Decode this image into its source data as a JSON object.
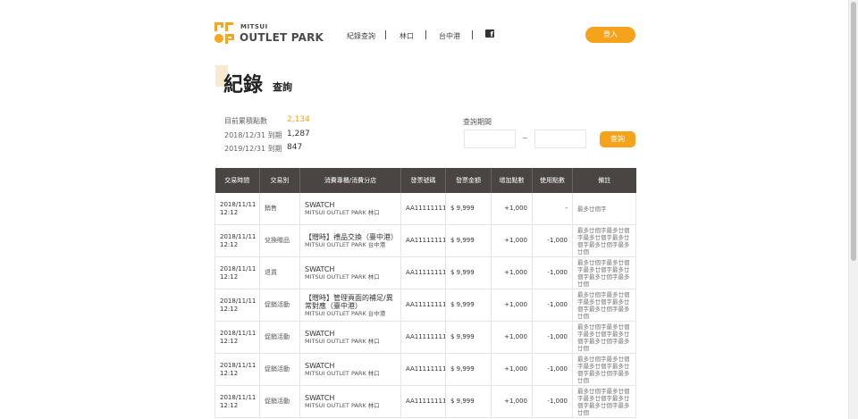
{
  "logo": {
    "small": "MITSUI",
    "big": "OUTLET PARK"
  },
  "nav": {
    "items": [
      "紀錄查詢",
      "林口",
      "台中港"
    ],
    "facebook": "f"
  },
  "header": {
    "login_label": "登入"
  },
  "title": {
    "main": "紀錄",
    "sub": "查詢"
  },
  "points": [
    {
      "label": "目前累積點數",
      "value": "2,134"
    },
    {
      "label": "2018/12/31 到期",
      "value": "1,287"
    },
    {
      "label": "2019/12/31 到期",
      "value": "847"
    }
  ],
  "search": {
    "label": "查詢期間",
    "separator": "~",
    "start_value": "",
    "end_value": "",
    "button": "查詢"
  },
  "table": {
    "headers": [
      "交易時間",
      "交易別",
      "消費專櫃/消費分店",
      "發票號碼",
      "發票金額",
      "增加點數",
      "使用點數",
      "備註"
    ],
    "rows": [
      {
        "date": "2018/11/11",
        "time": "12:12",
        "type": "銷售",
        "brand": "SWATCH",
        "branch": "MITSUI OUTLET PARK 林口",
        "invoice": "AA11111111",
        "amount": "$ 9,999",
        "add": "+1,000",
        "use": "-",
        "note": "最多廿個字"
      },
      {
        "date": "2018/11/11",
        "time": "12:12",
        "type": "兌換贈品",
        "brand": "【贈時】禮品交換（臺中港）",
        "branch": "MITSUI OUTLET PARK 台中港",
        "invoice": "AA11111111",
        "amount": "$ 9,999",
        "add": "+1,000",
        "use": "-1,000",
        "note": "最多廿個字最多廿個字最多廿個字最多廿個字最多廿個字最多廿個"
      },
      {
        "date": "2018/11/11",
        "time": "12:12",
        "type": "退貨",
        "brand": "SWATCH",
        "branch": "MITSUI OUTLET PARK 林口",
        "invoice": "AA11111111",
        "amount": "$ 9,999",
        "add": "+1,000",
        "use": "-1,000",
        "note": "最多廿個字最多廿個字最多廿個字最多廿個字最多廿個字最多廿個"
      },
      {
        "date": "2018/11/11",
        "time": "12:12",
        "type": "促銷活動",
        "brand": "【贈時】管理頁面的補足/異常對應（臺中港）",
        "branch": "MITSUI OUTLET PARK 台中港",
        "invoice": "AA11111111",
        "amount": "$ 9,999",
        "add": "+1,000",
        "use": "-1,000",
        "note": "最多廿個字最多廿個字最多廿個字最多廿個字最多廿個字最多廿個"
      },
      {
        "date": "2018/11/11",
        "time": "12:12",
        "type": "促銷活動",
        "brand": "SWATCH",
        "branch": "MITSUI OUTLET PARK 林口",
        "invoice": "AA11111111",
        "amount": "$ 9,999",
        "add": "+1,000",
        "use": "-1,000",
        "note": "最多廿個字最多廿個字最多廿個字最多廿個字最多廿個字最多廿個"
      },
      {
        "date": "2018/11/11",
        "time": "12:12",
        "type": "促銷活動",
        "brand": "SWATCH",
        "branch": "MITSUI OUTLET PARK 林口",
        "invoice": "AA11111111",
        "amount": "$ 9,999",
        "add": "+1,000",
        "use": "-1,000",
        "note": "最多廿個字最多廿個字最多廿個字最多廿個字最多廿個字最多廿個"
      },
      {
        "date": "2018/11/11",
        "time": "12:12",
        "type": "促銷活動",
        "brand": "SWATCH",
        "branch": "MITSUI OUTLET PARK 林口",
        "invoice": "AA11111111",
        "amount": "$ 9,999",
        "add": "+1,000",
        "use": "-1,000",
        "note": "最多廿個字最多廿個字最多廿個字最多廿個字最多廿個字最多廿個"
      }
    ]
  },
  "colors": {
    "accent": "#f5a31a",
    "table_header": "#4a4542"
  }
}
